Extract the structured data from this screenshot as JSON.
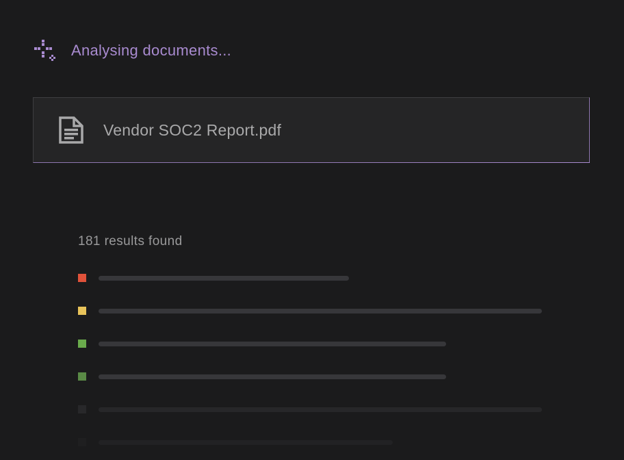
{
  "status": {
    "text": "Analysing documents...",
    "icon": "sparkle-icon",
    "color": "#a98bd0"
  },
  "file": {
    "name": "Vendor SOC2 Report.pdf",
    "icon": "document-icon"
  },
  "results": {
    "summary": "181 results found",
    "items": [
      {
        "severity_color": "#e0523a",
        "fade": 1.0
      },
      {
        "severity_color": "#e8c35a",
        "fade": 1.0
      },
      {
        "severity_color": "#6aab4c",
        "fade": 1.0
      },
      {
        "severity_color": "#5a8a46",
        "fade": 1.0
      },
      {
        "severity_color": "#3a3a3c",
        "fade": 0.45
      },
      {
        "severity_color": "#2a2a2c",
        "fade": 0.25
      }
    ]
  }
}
